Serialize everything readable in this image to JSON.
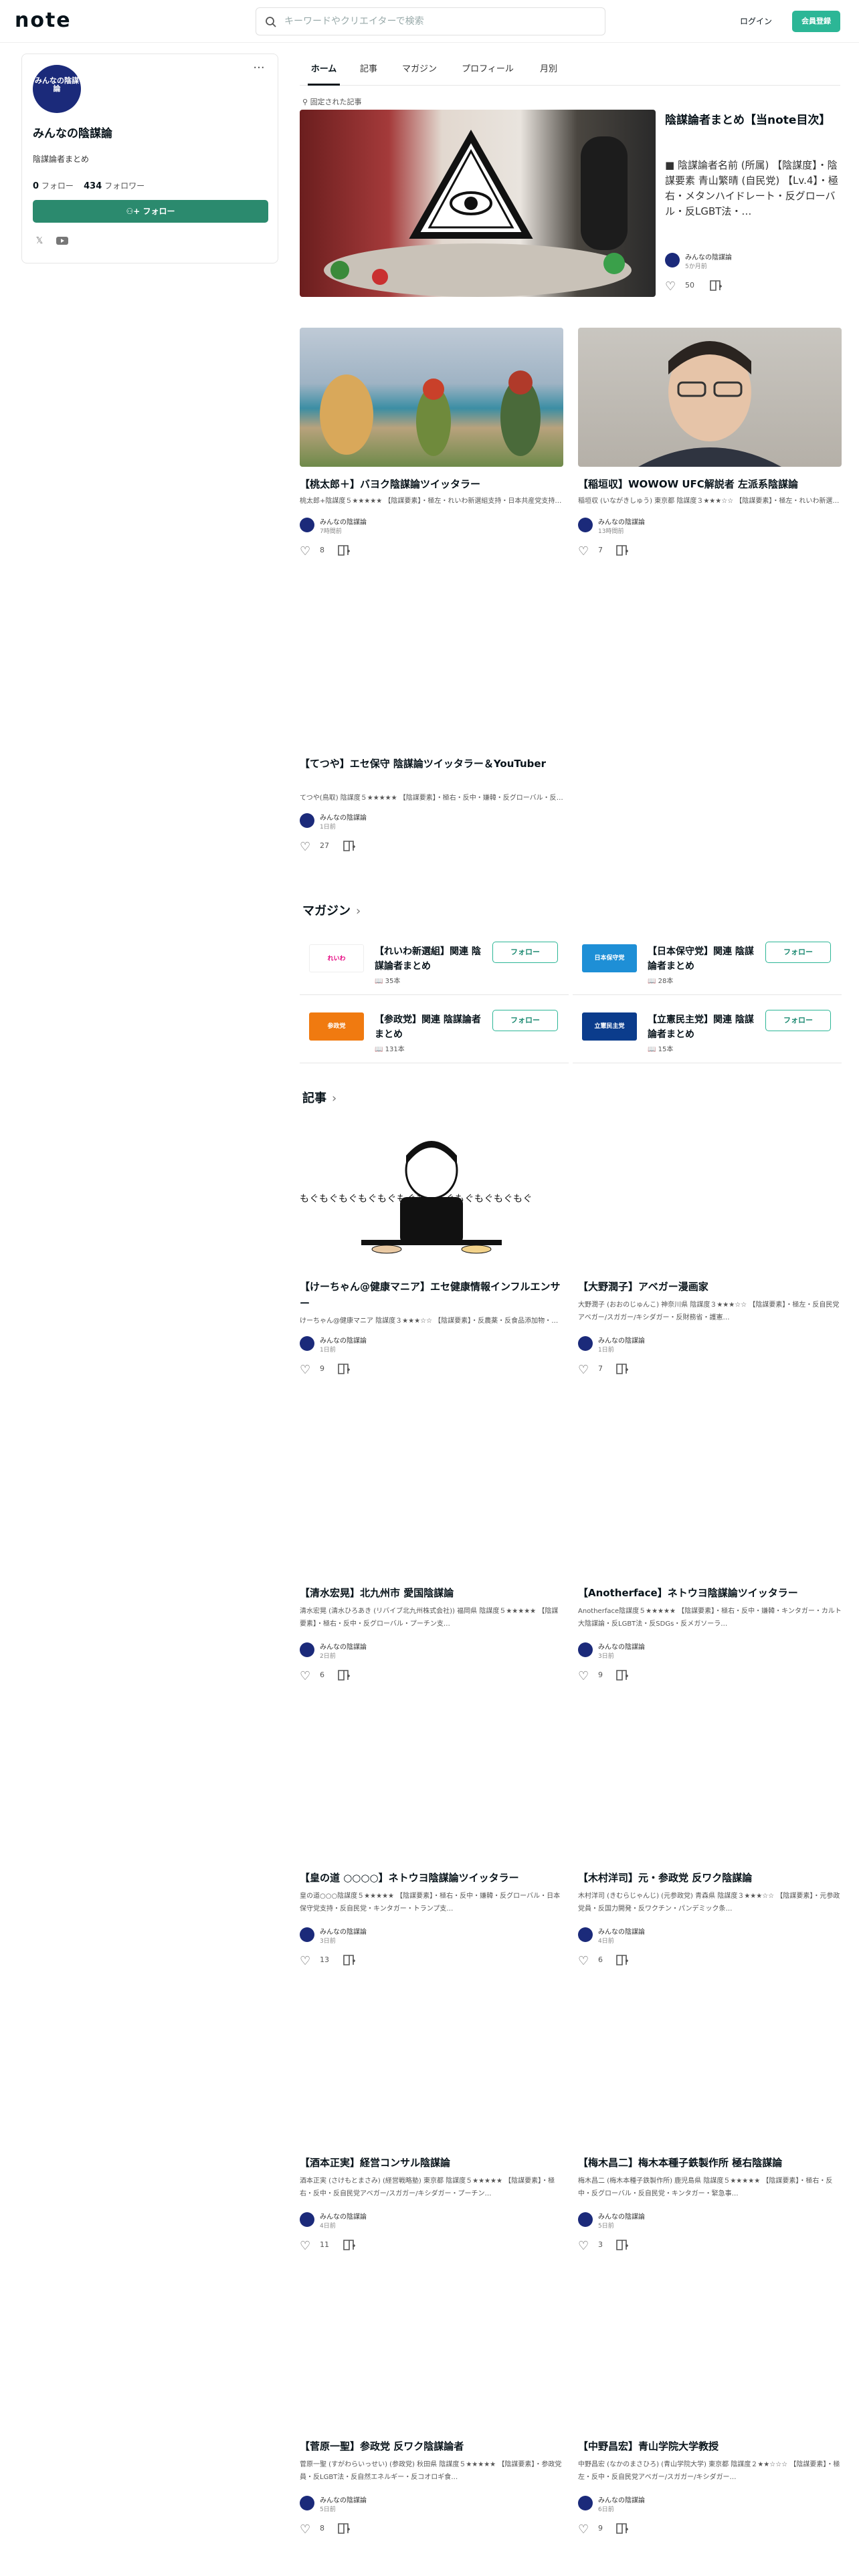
{
  "header": {
    "logo": "note",
    "search_placeholder": "キーワードやクリエイターで検索",
    "login": "ログイン",
    "signup": "会員登録",
    "accent": "#2cb696"
  },
  "profile": {
    "avatar_text": "みんなの陰謀論",
    "name": "みんなの陰謀論",
    "bio": "陰謀論者まとめ",
    "following_count": "0",
    "following_label": " フォロー",
    "followers_count": "434",
    "followers_label": " フォロワー",
    "follow_label": "フォロー"
  },
  "tabs": [
    "ホーム",
    "記事",
    "マガジン",
    "プロフィール",
    "月別"
  ],
  "pinned": {
    "label": "固定された記事",
    "title": "陰謀論者まとめ【当note目次】",
    "excerpt": "■ 陰謀論者名前 (所属) 【陰謀度】・陰謀要素 青山繁晴 (自民党) 【Lv.4】・極右・メタンハイドレート・反グローバル・反LGBT法・…",
    "author": "みんなの陰謀論",
    "time": "5か月前",
    "likes": "50"
  },
  "articles_top": [
    {
      "title": "【桃太郎＋】バヨク陰謀論ツイッタラー",
      "excerpt": "桃太郎+陰謀度５★★★★★ 【陰謀要素】・極左・れいわ新選組支持・日本共産党支持・反戦・反自民党",
      "author": "みんなの陰謀論",
      "time": "7時間前",
      "likes": "8"
    },
    {
      "title": "【稲垣収】WOWOW UFC解説者 左派系陰謀論",
      "excerpt": "稲垣収 (いながきしゅう) 東京都 陰謀度３★★★☆☆ 【陰謀要素】・極左・れいわ新選組支持・日本共産党支持・反戦",
      "author": "みんなの陰謀論",
      "time": "13時間前",
      "likes": "7"
    },
    {
      "title": "【てつや】エセ保守 陰謀論ツイッタラー＆YouTuber",
      "excerpt": "てつや(鳥取) 陰謀度５★★★★★ 【陰謀要素】・極右・反中・嫌韓・反グローバル・反自民党・キンタガー・日本保守党支持・トランプ…",
      "author": "みんなの陰謀論",
      "time": "1日前",
      "likes": "27"
    }
  ],
  "magazine": {
    "heading": "マガジン",
    "items": [
      {
        "title": "【れいわ新選組】関連 陰謀論者まとめ",
        "count": "35本",
        "thumb_text": "れいわ",
        "color": "#e6007e"
      },
      {
        "title": "【日本保守党】関連 陰謀論者まとめ",
        "count": "28本",
        "thumb_text": "日本保守党",
        "color": "#1e8fd6"
      },
      {
        "title": "【参政党】関連 陰謀論者まとめ",
        "count": "131本",
        "thumb_text": "参政党",
        "color": "#f07a10"
      },
      {
        "title": "【立憲民主党】関連 陰謀論者まとめ",
        "count": "15本",
        "thumb_text": "立憲民主党",
        "color": "#0b3c8c"
      }
    ]
  },
  "articles": {
    "heading": "記事",
    "items": [
      {
        "title": "【けーちゃん@健康マニア】エセ健康情報インフルエンサー",
        "excerpt": "けーちゃん@健康マニア 陰謀度３★★★☆☆ 【陰謀要素】・反農薬・反食品添加物・反遺伝子組み換え食品・オーガニック・自然・水素…",
        "author": "みんなの陰謀論",
        "time": "1日前",
        "likes": "9",
        "banner": "もぐもぐもぐもぐもぐもぐもぐもぐもぐもぐもぐもぐ"
      },
      {
        "title": "【大野潤子】アベガー漫画家",
        "excerpt": "大野潤子 (おおのじゅんこ) 神奈川県 陰謀度３★★★☆☆ 【陰謀要素】・極左・反自民党アベガー/スガガー/キシダガー・反財務省・護憲…",
        "author": "みんなの陰謀論",
        "time": "1日前",
        "likes": "7"
      },
      {
        "title": "【清水宏晃】北九州市 愛国陰謀論",
        "excerpt": "清水宏晃 (清水ひろあき (リバイブ北九州株式会社)) 福岡県 陰謀度５★★★★★ 【陰謀要素】・極右・反中・反グローバル・プーチン支…",
        "author": "みんなの陰謀論",
        "time": "2日前",
        "likes": "6"
      },
      {
        "title": "【Anotherface】ネトウヨ陰謀論ツイッタラー",
        "excerpt": "Anotherface陰謀度５★★★★★ 【陰謀要素】・極右・反中・嫌韓・キンタガー・カルト大陰謀論・反LGBT法・反SDGs・反メガソーラ…",
        "author": "みんなの陰謀論",
        "time": "3日前",
        "likes": "9"
      },
      {
        "title": "【皇の道 ○○○○】ネトウヨ陰謀論ツイッタラー",
        "excerpt": "皇の道○○○陰謀度５★★★★★ 【陰謀要素】・極右・反中・嫌韓・反グローバル・日本保守党支持・反自民党・キンタガー・トランプ支…",
        "author": "みんなの陰謀論",
        "time": "3日前",
        "likes": "13"
      },
      {
        "title": "【木村洋司】元・参政党 反ワク陰謀論",
        "excerpt": "木村洋司 (きむらじゃんじ) (元参政党) 青森県 陰謀度３★★★☆☆ 【陰謀要素】・元参政党員・反国力開発・反ワクチン・パンデミック条…",
        "author": "みんなの陰謀論",
        "time": "4日前",
        "likes": "6"
      },
      {
        "title": "【酒本正実】経営コンサル陰謀論",
        "excerpt": "酒本正実 (さけもとまさみ) (経営戦略塾) 東京都 陰謀度５★★★★★ 【陰謀要素】・極右・反中・反自民党アベガー/スガガー/キシダガー・プーチン…",
        "author": "みんなの陰謀論",
        "time": "4日前",
        "likes": "11"
      },
      {
        "title": "【梅木昌二】梅木本種子鉄製作所 極右陰謀論",
        "excerpt": "梅木昌二 (梅木本種子鉄製作所) 鹿児島県 陰謀度５★★★★★ 【陰謀要素】・極右・反中・反グローバル・反自民党・キンタガー・緊急事…",
        "author": "みんなの陰謀論",
        "time": "5日前",
        "likes": "3"
      },
      {
        "title": "【菅原一聖】参政党 反ワク陰謀論者",
        "excerpt": "菅原一聖 (すがわらいっせい) (参政党) 秋田県 陰謀度５★★★★★ 【陰謀要素】・参政党員・反LGBT法・反自然エネルギー・反コオロギ食…",
        "author": "みんなの陰謀論",
        "time": "5日前",
        "likes": "8"
      },
      {
        "title": "【中野昌宏】青山学院大学教授",
        "excerpt": "中野昌宏 (なかのまさひろ) (青山学院大学) 東京都 陰謀度２★★☆☆☆ 【陰謀要素】・極左・反中・反自民党アベガー/スガガー/キシダガー…",
        "author": "みんなの陰謀論",
        "time": "6日前",
        "likes": "9"
      }
    ]
  }
}
